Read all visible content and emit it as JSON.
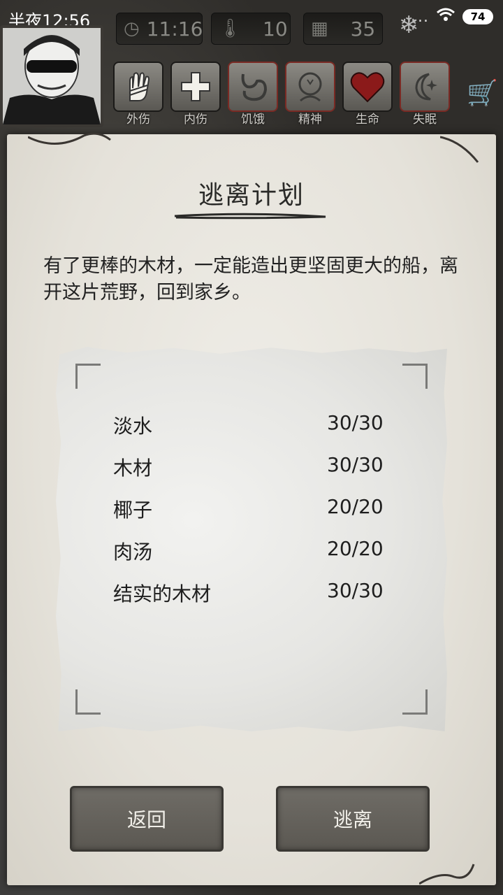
{
  "status_bar": {
    "time": "半夜12:56",
    "signal": "....",
    "battery": "74"
  },
  "top_stats": {
    "clock": "11:16",
    "temperature": "10",
    "day": "35"
  },
  "conditions": [
    {
      "label": "外伤",
      "icon": "bandaged-hand-icon"
    },
    {
      "label": "内伤",
      "icon": "cross-icon"
    },
    {
      "label": "饥饿",
      "icon": "stomach-icon"
    },
    {
      "label": "精神",
      "icon": "head-icon"
    },
    {
      "label": "生命",
      "icon": "heart-icon"
    },
    {
      "label": "失眠",
      "icon": "moon-star-icon"
    }
  ],
  "dialog": {
    "title": "逃离计划",
    "description": "有了更棒的木材，一定能造出更坚固更大的船，离开这片荒野，回到家乡。"
  },
  "requirements": [
    {
      "name": "淡水",
      "value": "30/30"
    },
    {
      "name": "木材",
      "value": "30/30"
    },
    {
      "name": "椰子",
      "value": "20/20"
    },
    {
      "name": "肉汤",
      "value": "20/20"
    },
    {
      "name": "结实的木材",
      "value": "30/30"
    }
  ],
  "buttons": {
    "back": "返回",
    "escape": "逃离"
  },
  "colors": {
    "paper": "#e9e6df",
    "button": "#66635d",
    "heart": "#8b1a1a"
  }
}
